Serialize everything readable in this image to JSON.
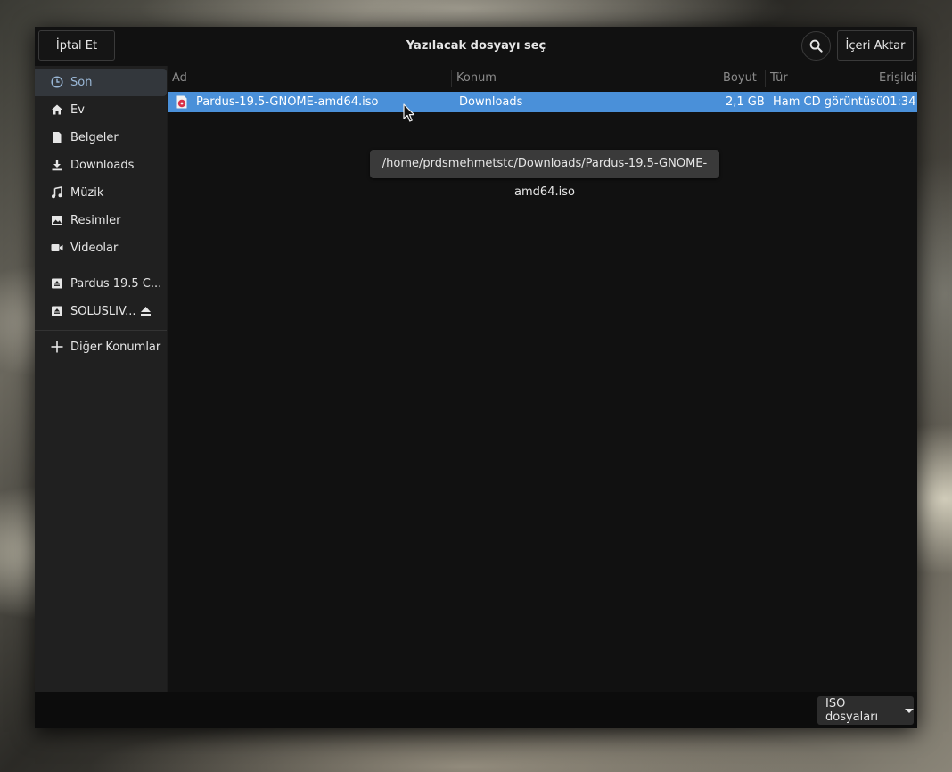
{
  "header": {
    "cancel_label": "İptal Et",
    "title": "Yazılacak dosyayı seç",
    "import_label": "İçeri Aktar",
    "search_icon": "search-icon"
  },
  "sidebar": {
    "places": [
      {
        "label": "Son",
        "icon": "clock-icon",
        "active": true
      },
      {
        "label": "Ev",
        "icon": "home-icon"
      },
      {
        "label": "Belgeler",
        "icon": "document-icon"
      },
      {
        "label": "Downloads",
        "icon": "download-icon"
      },
      {
        "label": "Müzik",
        "icon": "music-icon"
      },
      {
        "label": "Resimler",
        "icon": "image-icon"
      },
      {
        "label": "Videolar",
        "icon": "video-icon"
      }
    ],
    "devices": [
      {
        "label": "Pardus 19.5 C...",
        "icon": "drive-icon"
      },
      {
        "label": "SOLUSLIV...",
        "icon": "drive-icon",
        "eject": true
      }
    ],
    "other": {
      "label": "Diğer Konumlar",
      "icon": "plus-icon"
    }
  },
  "file_list": {
    "columns": [
      "Ad",
      "Konum",
      "Boyut",
      "Tür",
      "Erişildi"
    ],
    "rows": [
      {
        "name": "Pardus-19.5-GNOME-amd64.iso",
        "location": "Downloads",
        "size": "2,1 GB",
        "type": "Ham CD görüntüsü",
        "accessed": "01:34",
        "selected": true,
        "icon": "disc-image-icon"
      }
    ]
  },
  "tooltip": {
    "text": "/home/prdsmehmetstc/Downloads/Pardus-19.5-GNOME-amd64.iso"
  },
  "footer": {
    "filter_label": "ISO dosyaları"
  },
  "colors": {
    "selection": "#4a90d9",
    "sidebar_bg": "#202020",
    "main_bg": "#111111"
  }
}
